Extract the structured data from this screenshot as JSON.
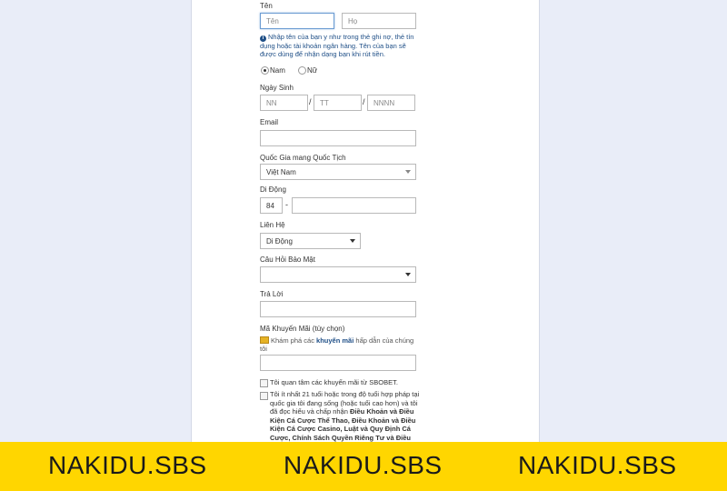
{
  "form": {
    "name": {
      "label": "Tên",
      "first_placeholder": "Tên",
      "last_placeholder": "Họ",
      "info_note": "Nhập tên của bạn y như trong thẻ ghi nợ, thẻ tín dụng hoặc tài khoản ngân hàng. Tên của bạn sẽ được dùng để nhận dạng bạn khi rút tiền."
    },
    "gender": {
      "options": [
        {
          "label": "Nam",
          "selected": true
        },
        {
          "label": "Nữ",
          "selected": false
        }
      ]
    },
    "birthdate": {
      "label": "Ngày Sinh",
      "day_placeholder": "NN",
      "month_placeholder": "TT",
      "year_placeholder": "NNNN",
      "separator": "/"
    },
    "email": {
      "label": "Email",
      "value": ""
    },
    "nationality": {
      "label": "Quốc Gia mang Quốc Tịch",
      "selected": "Việt Nam"
    },
    "mobile": {
      "label": "Di Động",
      "country_code": "84",
      "separator": "-",
      "value": ""
    },
    "contact": {
      "label": "Liên Hệ",
      "selected": "Di Động"
    },
    "security_question": {
      "label": "Câu Hỏi Bảo Mật",
      "selected": ""
    },
    "answer": {
      "label": "Trả Lời",
      "value": ""
    },
    "promo": {
      "label": "Mã Khuyến Mãi (tùy chọn)",
      "note_prefix": "Khám phá các",
      "note_link": "khuyến mãi",
      "note_suffix": "hấp dẫn của chúng tôi",
      "value": ""
    },
    "checkbox_promos": {
      "label": "Tôi quan tâm các khuyến mãi từ SBOBET.",
      "checked": false
    },
    "checkbox_terms": {
      "text_1": "Tôi ít nhất 21 tuổi hoặc trong độ tuổi hợp pháp tại quốc gia tôi đang sống (hoặc tuổi cao hơn) và tôi đã đọc hiểu và chấp nhận",
      "bold_1": "Điều Khoản và Điều Kiện Cá Cược Thể Thao, Điều Khoản và Điều Kiện Cá Cược Casino, Luật và Quy Định Cá Cược, Chính Sách Quyền Riêng Tư và Điều Khoản và Điều Khoản",
      "checked": false
    }
  },
  "banner": {
    "brand_1": "NAKIDU.SBS",
    "brand_2": "NAKIDU.SBS",
    "brand_3": "NAKIDU.SBS",
    "color": "#ffd600"
  }
}
